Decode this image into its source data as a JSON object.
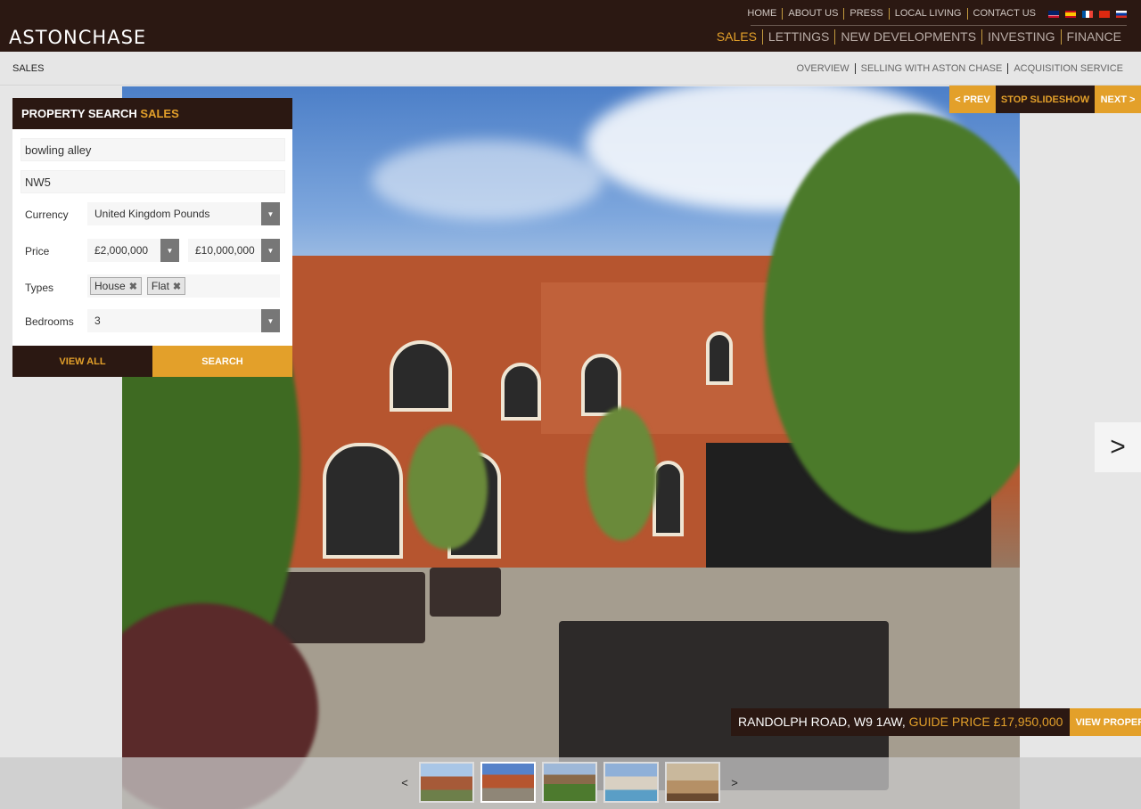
{
  "brand": {
    "logo": "ASTONCHASE"
  },
  "topnav": {
    "items": [
      "HOME",
      "ABOUT US",
      "PRESS",
      "LOCAL LIVING",
      "CONTACT US"
    ],
    "flags": [
      "uk-flag-icon",
      "spain-flag-icon",
      "france-flag-icon",
      "china-flag-icon",
      "russia-flag-icon"
    ]
  },
  "mainnav": {
    "items": [
      "SALES",
      "LETTINGS",
      "NEW DEVELOPMENTS",
      "INVESTING",
      "FINANCE"
    ],
    "active": "SALES"
  },
  "subbar": {
    "section": "SALES",
    "items": [
      "OVERVIEW",
      "SELLING WITH ASTON CHASE",
      "ACQUISITION SERVICE"
    ]
  },
  "slideshow": {
    "prev": "< PREV",
    "stop": "STOP SLIDESHOW",
    "next": "NEXT >",
    "big_next": ">"
  },
  "search": {
    "title": "PROPERTY SEARCH",
    "title_accent": "SALES",
    "keyword": "bowling alley",
    "location": "NW5",
    "currency_label": "Currency",
    "currency_value": "United Kingdom Pounds",
    "price_label": "Price",
    "price_min": "£2,000,000",
    "price_max": "£10,000,000",
    "types_label": "Types",
    "types": [
      "House",
      "Flat"
    ],
    "bedrooms_label": "Bedrooms",
    "bedrooms_value": "3",
    "view_all": "VIEW ALL",
    "search_button": "SEARCH"
  },
  "property": {
    "address": "RANDOLPH ROAD, W9 1AW,",
    "price": "GUIDE PRICE £17,950,000",
    "view_button": "VIEW PROPERTY"
  },
  "thumbnails": {
    "prev": "<",
    "next": ">",
    "count": 5,
    "active_index": 1
  },
  "colors": {
    "brown": "#2b1812",
    "gold": "#e3a02a"
  }
}
